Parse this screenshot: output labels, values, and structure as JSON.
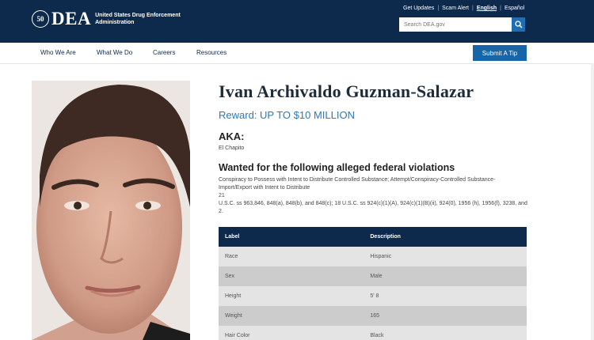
{
  "header": {
    "logo_seal": "50",
    "logo_text": "DEA",
    "agency_name": "United States Drug Enforcement Administration",
    "utility_links": [
      "Get Updates",
      "Scam Alert",
      "English",
      "Español"
    ],
    "search_placeholder": "Search DEA.gov",
    "background_color": "#0d2a4c"
  },
  "nav": {
    "items": [
      "Who We Are",
      "What We Do",
      "Careers",
      "Resources"
    ],
    "tip_button": "Submit A Tip",
    "tip_color": "#1565a8"
  },
  "profile": {
    "name": "Ivan Archivaldo Guzman-Salazar",
    "reward": "Reward: UP TO $10 MILLION",
    "aka_heading": "AKA:",
    "aka_value": "El Chapito",
    "violations_heading": "Wanted for the following alleged federal violations",
    "violations_lines": [
      "Conspiracy to Possess with Intent to Distribute Controlled Substance; Attempt/Conspiracy-Controlled Substance-Import/Export with Intent to Distribute",
      "21",
      "U.S.C. ss 963,846, 848(a), 848(b), and 848(c); 18 U.S.C. ss 924(c)(1)(A), 924(c)(1)(B)(ii), 924(0), 1956 (h), 1956(f), 3238, and 2."
    ]
  },
  "table": {
    "headers": [
      "Label",
      "Description"
    ],
    "rows": [
      [
        "Race",
        "Hispanic"
      ],
      [
        "Sex",
        "Male"
      ],
      [
        "Height",
        "5' 8"
      ],
      [
        "Weight",
        "165"
      ],
      [
        "Hair Color",
        "Black"
      ]
    ]
  }
}
